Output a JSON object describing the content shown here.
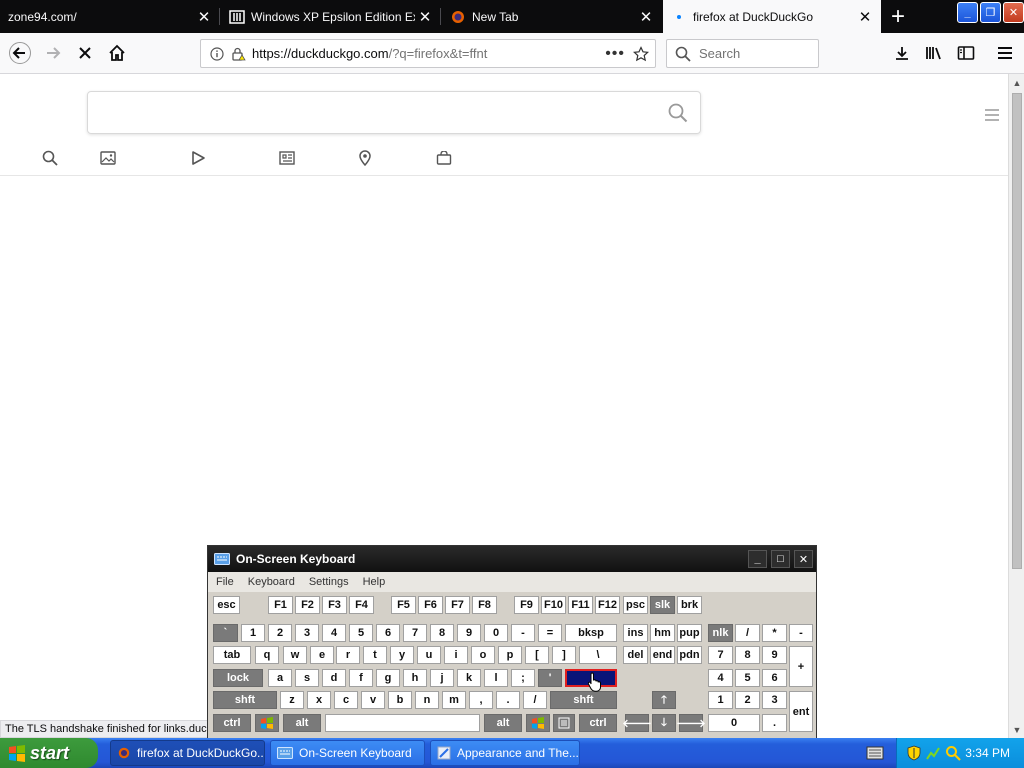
{
  "tabs": [
    {
      "label": "zone94.com/",
      "active": false
    },
    {
      "label": "Windows XP Epsilon Edition Extra",
      "active": false
    },
    {
      "label": "New Tab",
      "active": false
    },
    {
      "label": "firefox at DuckDuckGo",
      "active": true
    }
  ],
  "navbar": {
    "url_domain": "https://duckduckgo.com",
    "url_path": "/?q=firefox&t=ffnt",
    "search_placeholder": "Search"
  },
  "page": {
    "status_text": "The TLS handshake finished for links.duckduckgo.com..."
  },
  "osk": {
    "title": "On-Screen Keyboard",
    "menu": [
      "File",
      "Keyboard",
      "Settings",
      "Help"
    ],
    "rows": {
      "fn": [
        "esc",
        "F1",
        "F2",
        "F3",
        "F4",
        "F5",
        "F6",
        "F7",
        "F8",
        "F9",
        "F10",
        "F11",
        "F12",
        "psc",
        "slk",
        "brk"
      ],
      "num": [
        "`",
        "1",
        "2",
        "3",
        "4",
        "5",
        "6",
        "7",
        "8",
        "9",
        "0",
        "-",
        "=",
        "bksp",
        "ins",
        "hm",
        "pup",
        "nlk",
        "/",
        "*",
        "-"
      ],
      "tab": [
        "tab",
        "q",
        "w",
        "e",
        "r",
        "t",
        "y",
        "u",
        "i",
        "o",
        "p",
        "[",
        "]",
        "\\",
        "del",
        "end",
        "pdn",
        "7",
        "8",
        "9",
        "+"
      ],
      "caps": [
        "lock",
        "a",
        "s",
        "d",
        "f",
        "g",
        "h",
        "j",
        "k",
        "l",
        ";",
        "'",
        "4",
        "5",
        "6"
      ],
      "shift": [
        "shft",
        "z",
        "x",
        "c",
        "v",
        "b",
        "n",
        "m",
        ",",
        ".",
        "/",
        "shft",
        "1",
        "2",
        "3"
      ],
      "ctrl": [
        "ctrl",
        "alt",
        "alt",
        "ctrl",
        "0",
        ".",
        "ent"
      ]
    }
  },
  "taskbar": {
    "start_label": "start",
    "items": [
      "firefox at DuckDuckGo...",
      "On-Screen Keyboard",
      "Appearance and The..."
    ],
    "clock": "3:34 PM"
  }
}
